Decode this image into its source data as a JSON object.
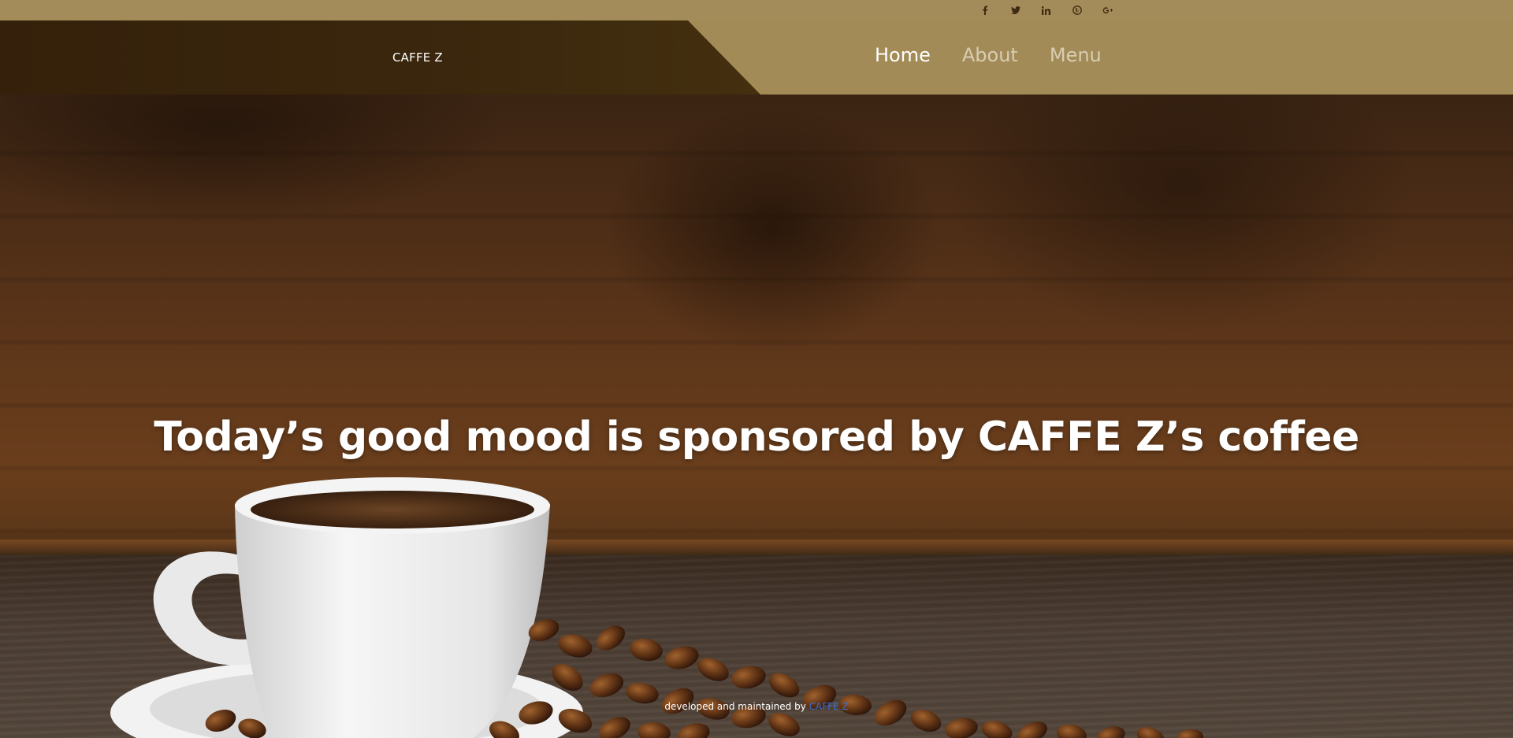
{
  "social": {
    "items": [
      {
        "name": "facebook",
        "glyph": "f"
      },
      {
        "name": "twitter",
        "glyph": "t"
      },
      {
        "name": "linkedin",
        "glyph": "in"
      },
      {
        "name": "pinterest",
        "glyph": "p"
      },
      {
        "name": "google-plus",
        "glyph": "g+"
      }
    ]
  },
  "header": {
    "brand": "CAFFE Z",
    "nav": [
      {
        "label": "Home",
        "active": true
      },
      {
        "label": "About",
        "active": false
      },
      {
        "label": "Menu",
        "active": false
      }
    ]
  },
  "hero": {
    "headline": "Today’s good mood is sponsored by CAFFE Z’s coffee"
  },
  "footer": {
    "credit_text": "developed and maintained by",
    "credit_link": "CAFFE Z"
  },
  "colors": {
    "gold_bar": "#a48c5a",
    "dark_brown": "#35210b",
    "nav_active": "#ffffff",
    "nav_inactive": "#d8cdb4",
    "credit_link": "#3a6fd0"
  }
}
